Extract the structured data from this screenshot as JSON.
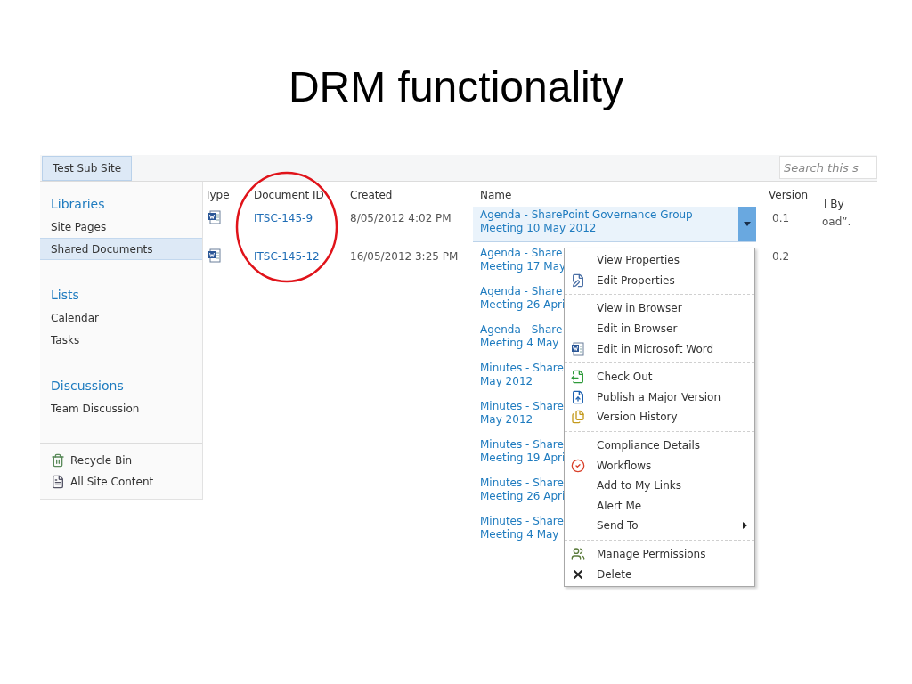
{
  "slide_title": "DRM functionality",
  "site_tab": {
    "label": "Test Sub Site",
    "selected": true
  },
  "search": {
    "placeholder": "Search this s"
  },
  "nav": {
    "sections": [
      {
        "heading": "Libraries",
        "items": [
          {
            "label": "Site Pages",
            "selected": false
          },
          {
            "label": "Shared Documents",
            "selected": true
          }
        ]
      },
      {
        "heading": "Lists",
        "items": [
          {
            "label": "Calendar",
            "selected": false
          },
          {
            "label": "Tasks",
            "selected": false
          }
        ]
      },
      {
        "heading": "Discussions",
        "items": [
          {
            "label": "Team Discussion",
            "selected": false
          }
        ]
      }
    ],
    "footer_links": [
      "Recycle Bin",
      "All Site Content"
    ]
  },
  "table": {
    "columns": [
      "Type",
      "Document ID",
      "Created",
      "Name",
      "Version",
      "l By"
    ],
    "rows": [
      {
        "kind": "doc",
        "document_id": "ITSC-145-9",
        "created": "8/05/2012 4:02 PM",
        "name_lines": [
          "Agenda - SharePoint Governance Group",
          "Meeting 10 May 2012"
        ],
        "version": "0.1",
        "column_6": "oad”.",
        "selected": true
      },
      {
        "kind": "doc",
        "document_id": "ITSC-145-12",
        "created": "16/05/2012 3:25 PM",
        "name_lines": [
          "Agenda - Share",
          "Meeting 17 May"
        ],
        "version": "0.2",
        "selected": false
      },
      {
        "kind": "name_only",
        "name_lines": [
          "Agenda - Share",
          "Meeting 26 Apri"
        ],
        "selected": false
      },
      {
        "kind": "name_only",
        "name_lines": [
          "Agenda - Share",
          "Meeting 4 May"
        ],
        "selected": false
      },
      {
        "kind": "name_only",
        "name_lines": [
          "Minutes - Share",
          "May 2012"
        ],
        "selected": false
      },
      {
        "kind": "name_only",
        "name_lines": [
          "Minutes - Share",
          "May 2012"
        ],
        "selected": false
      },
      {
        "kind": "name_only",
        "name_lines": [
          "Minutes - Share",
          "Meeting 19 Apri"
        ],
        "selected": false
      },
      {
        "kind": "name_only",
        "name_lines": [
          "Minutes - Share",
          "Meeting 26 Apri"
        ],
        "selected": false
      },
      {
        "kind": "name_only",
        "name_lines": [
          "Minutes - Share",
          "Meeting 4 May"
        ],
        "selected": false
      }
    ]
  },
  "context_menu": {
    "groups": [
      [
        {
          "label": "View Properties",
          "has_submenu": false
        },
        {
          "label": "Edit Properties",
          "has_submenu": false
        }
      ],
      [
        {
          "label": "View in Browser",
          "has_submenu": false
        },
        {
          "label": "Edit in Browser",
          "has_submenu": false
        },
        {
          "label": "Edit in Microsoft Word",
          "has_submenu": false
        }
      ],
      [
        {
          "label": "Check Out",
          "has_submenu": false
        },
        {
          "label": "Publish a Major Version",
          "has_submenu": false
        },
        {
          "label": "Version History",
          "has_submenu": false
        }
      ],
      [
        {
          "label": "Compliance Details",
          "has_submenu": false
        },
        {
          "label": "Workflows",
          "has_submenu": false
        },
        {
          "label": "Add to My Links",
          "has_submenu": false
        },
        {
          "label": "Alert Me",
          "has_submenu": false
        },
        {
          "label": "Send To",
          "has_submenu": true
        }
      ],
      [
        {
          "label": "Manage Permissions",
          "has_submenu": false
        },
        {
          "label": "Delete",
          "has_submenu": false
        }
      ]
    ]
  }
}
